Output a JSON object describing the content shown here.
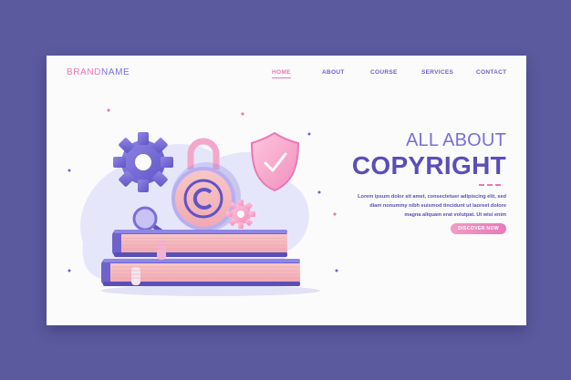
{
  "brand": {
    "part1": "BRAND",
    "part2": "NAME"
  },
  "nav": {
    "items": [
      {
        "label": "HOME",
        "active": true
      },
      {
        "label": "ABOUT",
        "active": false
      },
      {
        "label": "COURSE",
        "active": false
      },
      {
        "label": "SERVICES",
        "active": false
      },
      {
        "label": "CONTACT",
        "active": false
      }
    ]
  },
  "hero": {
    "title_line1": "ALL ABOUT",
    "title_line2": "COPYRIGHT",
    "body_lines": [
      "Lorem ipsum dolor sit amet, consectetuer adipiscing elit, sed",
      "diam nonummy nibh euismod tincidunt ut laoreet dolore",
      "magna aliquam erat volutpat. Ut wisi enim"
    ],
    "cta_label": "DISCOVER NOW"
  },
  "illustration": {
    "icons": [
      "gear-icon",
      "padlock-icon",
      "copyright-icon",
      "shield-check-icon",
      "magnifier-icon",
      "books-icon"
    ]
  },
  "colors": {
    "background": "#5b5a9e",
    "card": "#fbfbfb",
    "accent_pink": "#e879b8",
    "accent_purple": "#6e63c9",
    "title_purple": "#5a4fb8"
  }
}
